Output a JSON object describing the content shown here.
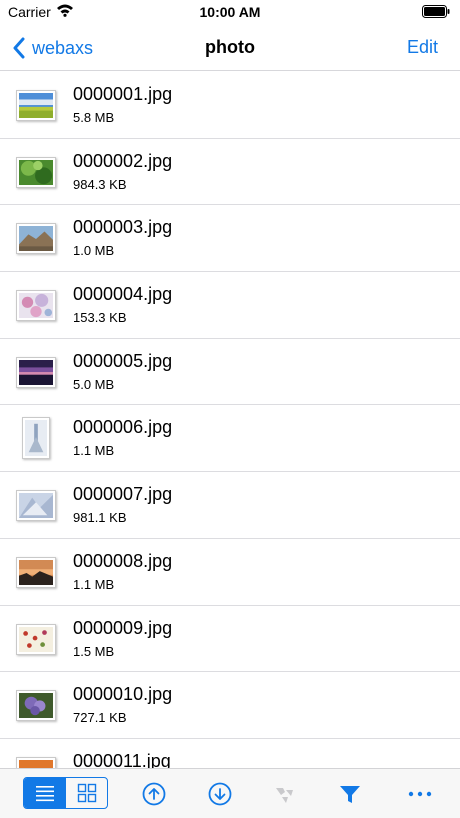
{
  "status_bar": {
    "carrier": "Carrier",
    "time": "10:00 AM"
  },
  "nav": {
    "back_label": "webaxs",
    "title": "photo",
    "edit_label": "Edit"
  },
  "files": [
    {
      "name": "0000001.jpg",
      "size": "5.8 MB"
    },
    {
      "name": "0000002.jpg",
      "size": "984.3 KB"
    },
    {
      "name": "0000003.jpg",
      "size": "1.0 MB"
    },
    {
      "name": "0000004.jpg",
      "size": "153.3 KB"
    },
    {
      "name": "0000005.jpg",
      "size": "5.0 MB"
    },
    {
      "name": "0000006.jpg",
      "size": "1.1 MB"
    },
    {
      "name": "0000007.jpg",
      "size": "981.1 KB"
    },
    {
      "name": "0000008.jpg",
      "size": "1.1 MB"
    },
    {
      "name": "0000009.jpg",
      "size": "1.5 MB"
    },
    {
      "name": "0000010.jpg",
      "size": "727.1 KB"
    },
    {
      "name": "0000011.jpg",
      "size": ""
    }
  ],
  "toolbar": {
    "accent_color": "#1279e6",
    "view_mode": "list",
    "icons": [
      "list-view-icon",
      "grid-view-icon",
      "upload-icon",
      "download-icon",
      "move-icon",
      "filter-icon",
      "more-icon"
    ]
  }
}
